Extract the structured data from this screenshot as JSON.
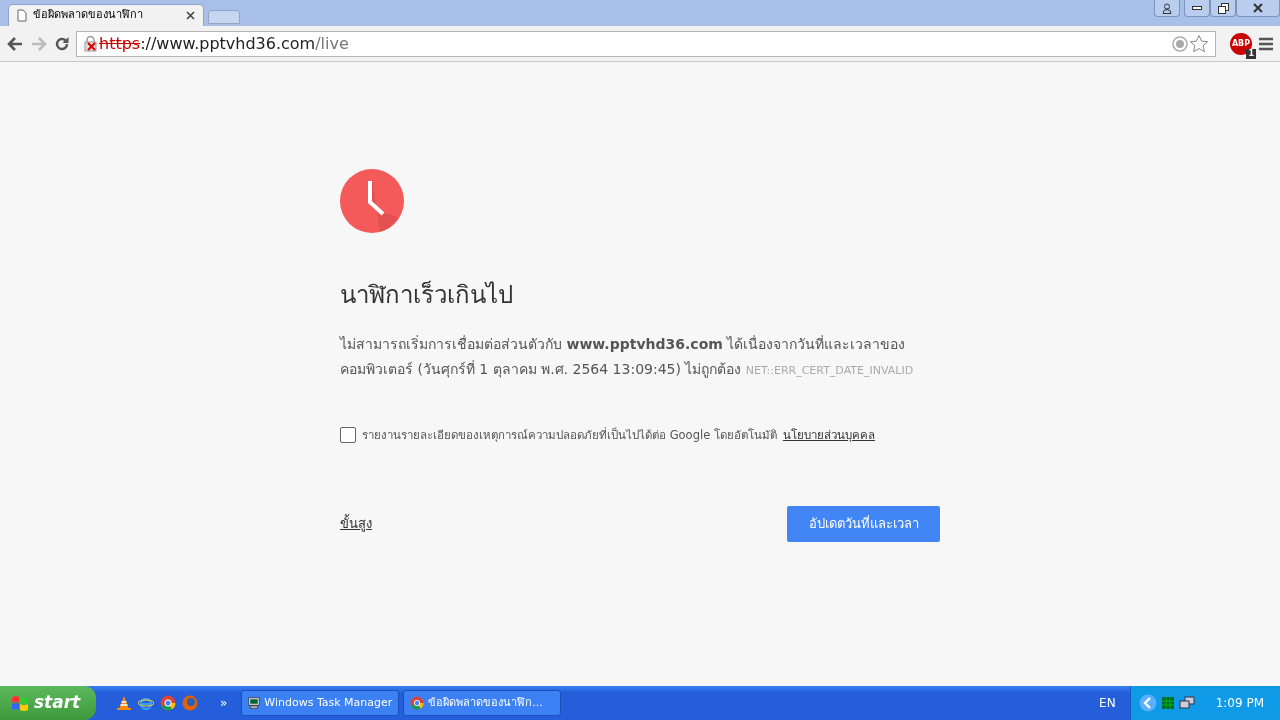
{
  "browser": {
    "tabs": [
      {
        "title": "ข้อผิดพลาดของนาฬิกา",
        "selected": true
      }
    ],
    "address": {
      "scheme": "https",
      "host": "://www.pptvhd36.com",
      "path": "/live",
      "secure": false
    },
    "extension": {
      "label": "ABP",
      "count": "1"
    }
  },
  "page": {
    "title": "นาฬิกาเร็วเกินไป",
    "message": "ไม่สามารถเริ่มการเชื่อมต่อส่วนตัวกับ **www.pptvhd36.com** ได้เนื่องจากวันที่และเวลาของคอมพิวเตอร์ (วันศุกร์ที่ 1 ตุลาคม พ.ศ. 2564 13:09:45) ไม่ถูกต้อง",
    "error_code": "NET::ERR_CERT_DATE_INVALID",
    "report": {
      "checked": false,
      "label": "รายงานรายละเอียดของเหตุการณ์ความปลอดภัยที่เป็นไปได้ต่อ Google โดยอัตโนมัติ",
      "link": "นโยบายส่วนบุคคล"
    },
    "advanced_link": "ขั้นสูง",
    "button": "อัปเดตวันที่และเวลา"
  },
  "taskbar": {
    "start": "start",
    "overflow": "»",
    "tasks": [
      {
        "label": "Windows Task Manager",
        "kind": "monitor",
        "selected": false
      },
      {
        "label": "ข้อผิดพลาดของนาฬิก...",
        "kind": "browser",
        "selected": false
      }
    ],
    "language": "EN",
    "clock": "1:09 PM"
  }
}
